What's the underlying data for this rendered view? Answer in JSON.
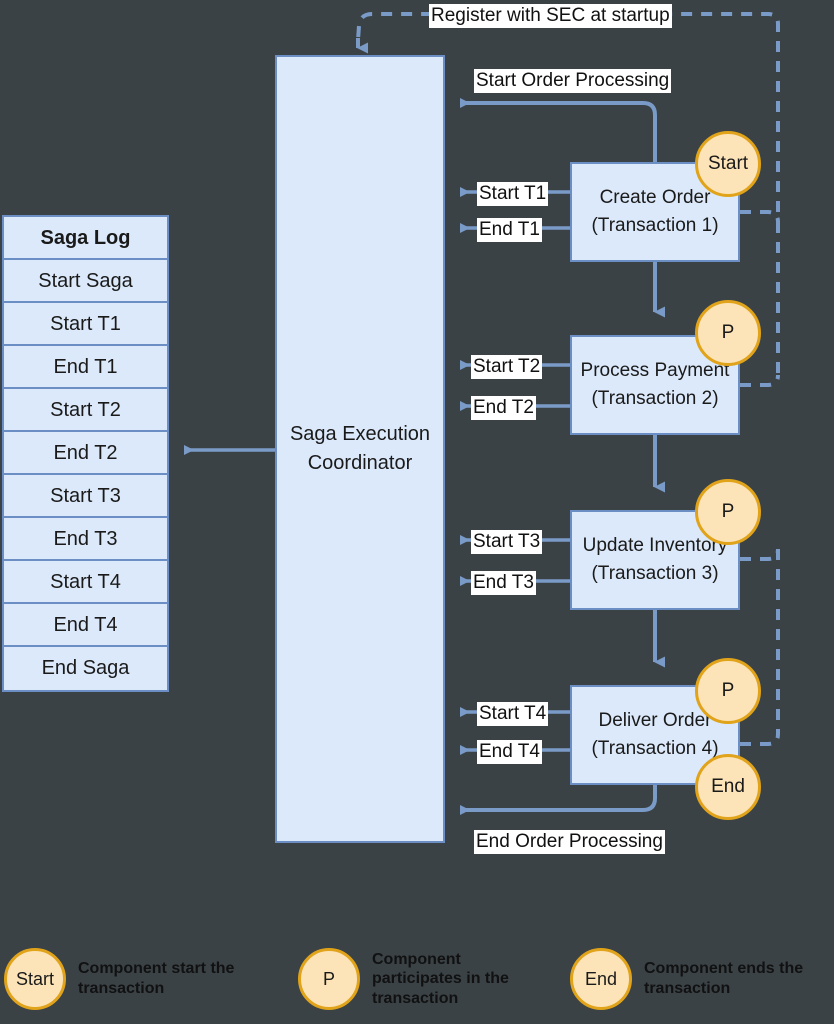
{
  "diagram": {
    "title": "Saga Execution Coordinator",
    "background_color": "#3a4246",
    "box_fill": "#dce9fa",
    "box_border": "#6b8ec4",
    "badge_fill": "#fce3b8",
    "badge_border": "#e0a31a",
    "connector_color": "#7a9bc8"
  },
  "saga_log": {
    "header": "Saga Log",
    "entries": [
      "Start Saga",
      "Start T1",
      "End T1",
      "Start T2",
      "End T2",
      "Start T3",
      "End T3",
      "Start T4",
      "End T4",
      "End Saga"
    ]
  },
  "coordinator": {
    "line1": "Saga Execution",
    "line2": "Coordinator"
  },
  "transactions": [
    {
      "name": "Create Order",
      "subtitle": "(Transaction 1)",
      "badge": "Start",
      "start_label": "Start T1",
      "end_label": "End T1"
    },
    {
      "name": "Process Payment",
      "subtitle": "(Transaction 2)",
      "badge": "P",
      "start_label": "Start T2",
      "end_label": "End T2"
    },
    {
      "name": "Update Inventory",
      "subtitle": "(Transaction 3)",
      "badge": "P",
      "start_label": "Start T3",
      "end_label": "End T3"
    },
    {
      "name": "Deliver Order",
      "subtitle": "(Transaction 4)",
      "badge": "P",
      "end_badge": "End",
      "start_label": "Start T4",
      "end_label": "End T4"
    }
  ],
  "flow_labels": {
    "register": "Register with SEC at startup",
    "start_processing": "Start Order Processing",
    "end_processing": "End Order Processing"
  },
  "legend": [
    {
      "badge": "Start",
      "line1": "Component start the",
      "line2": "transaction",
      "line3": ""
    },
    {
      "badge": "P",
      "line1": "Component",
      "line2": "participates in the",
      "line3": "transaction"
    },
    {
      "badge": "End",
      "line1": "Component ends the",
      "line2": "transaction",
      "line3": ""
    }
  ]
}
